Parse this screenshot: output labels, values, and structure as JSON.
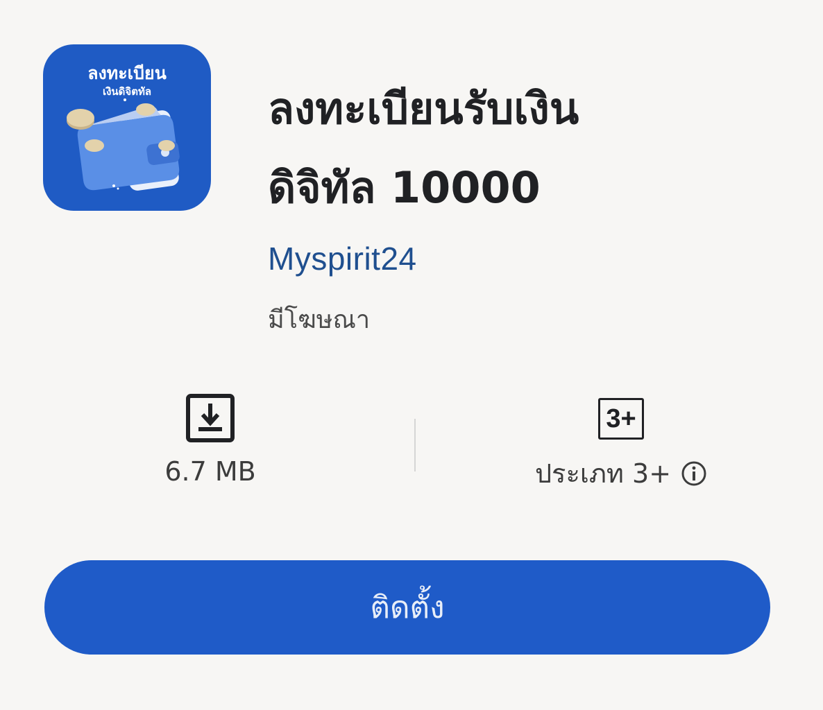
{
  "app": {
    "icon": {
      "title": "ลงทะเบียน",
      "subtitle": "เงินดิจิตทัล",
      "background_color": "#1f5bc4",
      "icon_name": "wallet-with-coins-icon"
    },
    "title_line1": "ลงทะเบียนรับเงิน",
    "title_line2": "ดิจิทัล 10000",
    "developer": "Myspirit24",
    "ads_label": "มีโฆษณา"
  },
  "stats": {
    "size": {
      "icon": "download-icon",
      "value": "6.7 MB"
    },
    "rating": {
      "badge": "3+",
      "label": "ประเภท 3+",
      "info_icon": "info-icon"
    }
  },
  "install_button": {
    "label": "ติดตั้ง",
    "color": "#1f5bc8"
  }
}
